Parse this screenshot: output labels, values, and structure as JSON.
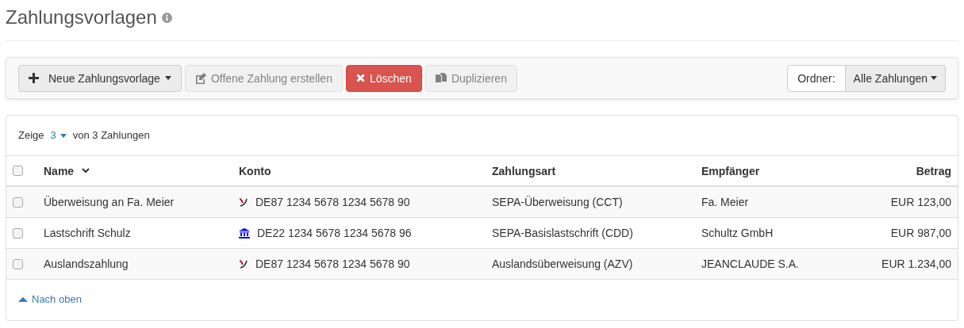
{
  "page": {
    "title": "Zahlungsvorlagen"
  },
  "toolbar": {
    "buttons": [
      {
        "label": "Neue Zahlungsvorlage",
        "kind": "new",
        "disabled": false
      },
      {
        "label": "Offene Zahlung erstellen",
        "kind": "edit",
        "disabled": true
      },
      {
        "label": "Löschen",
        "kind": "delete",
        "disabled": false
      },
      {
        "label": "Duplizieren",
        "kind": "copy",
        "disabled": true
      }
    ],
    "folder": {
      "label": "Ordner:",
      "value": "Alle Zahlungen"
    }
  },
  "list": {
    "show_prefix": "Zeige",
    "show_count": "3",
    "show_suffix": "von 3 Zahlungen"
  },
  "table": {
    "all_checked": false,
    "columns": [
      "Name",
      "Konto",
      "Zahlungsart",
      "Empfänger",
      "Betrag"
    ],
    "rows": [
      {
        "checked": false,
        "name": "Überweisung an Fa. Meier",
        "account": {
          "kind": "logo",
          "iban": "DE87 1234 5678 1234 5678 90"
        },
        "type": "SEPA-Überweisung (CCT)",
        "recipient": "Fa. Meier",
        "amount": "EUR 123,00"
      },
      {
        "checked": false,
        "name": "Lastschrift Schulz",
        "account": {
          "kind": "bank",
          "iban": "DE22 1234 5678 1234 5678 96"
        },
        "type": "SEPA-Basislastschrift (CDD)",
        "recipient": "Schultz GmbH",
        "amount": "EUR 987,00"
      },
      {
        "checked": false,
        "name": "Auslandszahlung",
        "account": {
          "kind": "logo",
          "iban": "DE87 1234 5678 1234 5678 90"
        },
        "type": "Auslandsüberweisung (AZV)",
        "recipient": "JEANCLAUDE S.A.",
        "amount": "EUR 1.234,00"
      }
    ]
  },
  "footer": {
    "link": "Nach oben"
  }
}
